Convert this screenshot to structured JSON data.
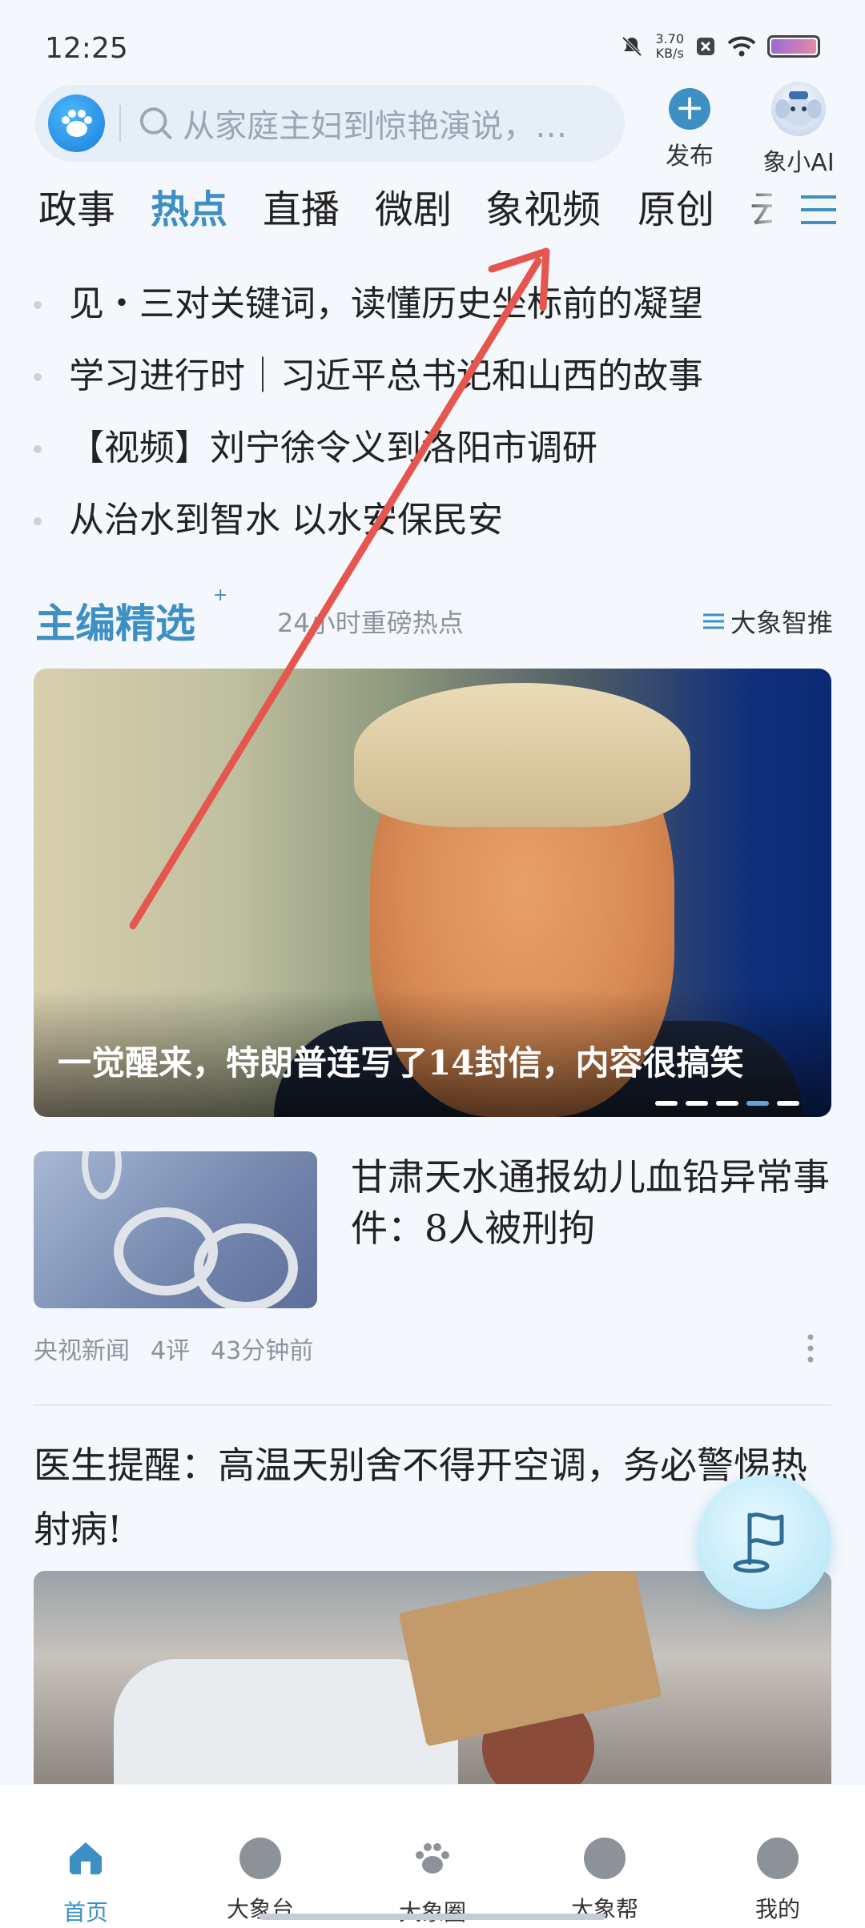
{
  "status": {
    "time": "12:25",
    "net_speed_value": "3.70",
    "net_speed_unit": "KB/s"
  },
  "header": {
    "search_placeholder": "从家庭主妇到惊艳演说，…",
    "publish_label": "发布",
    "ai_label": "象小AI"
  },
  "tabs": [
    {
      "label": "政事"
    },
    {
      "label": "热点",
      "active": true
    },
    {
      "label": "直播"
    },
    {
      "label": "微剧"
    },
    {
      "label": "象视频"
    },
    {
      "label": "原创"
    },
    {
      "label": "云"
    }
  ],
  "headlines": [
    {
      "text": "见・三对关键词，读懂历史坐标前的凝望"
    },
    {
      "text": "学习进行时｜习近平总书记和山西的故事"
    },
    {
      "text": "【视频】刘宁徐令义到洛阳市调研"
    },
    {
      "text": "从治水到智水  以水安保民安"
    }
  ],
  "section": {
    "title": "主编精选",
    "title_sup": "+",
    "subtitle": "24小时重磅热点",
    "right_label": "大象智推"
  },
  "hero": {
    "caption": "一觉醒来，特朗普连写了14封信，内容很搞笑",
    "slides_total": 5,
    "active_slide": 4
  },
  "article1": {
    "title": "甘肃天水通报幼儿血铅异常事件：8人被刑拘",
    "source": "央视新闻",
    "comments": "4评",
    "time": "43分钟前"
  },
  "article2": {
    "title": "医生提醒：高温天别舍不得开空调，务必警惕热射病!"
  },
  "bottom_nav": [
    {
      "label": "首页",
      "icon": "home-icon",
      "active": true
    },
    {
      "label": "大象台",
      "icon": "broadcast-icon"
    },
    {
      "label": "大象圈",
      "icon": "paw-icon"
    },
    {
      "label": "大象帮",
      "icon": "help-icon"
    },
    {
      "label": "我的",
      "icon": "profile-icon"
    }
  ],
  "colors": {
    "accent": "#3d8fc4",
    "background": "#f4f8fc",
    "annotation_arrow": "#e5564f"
  }
}
